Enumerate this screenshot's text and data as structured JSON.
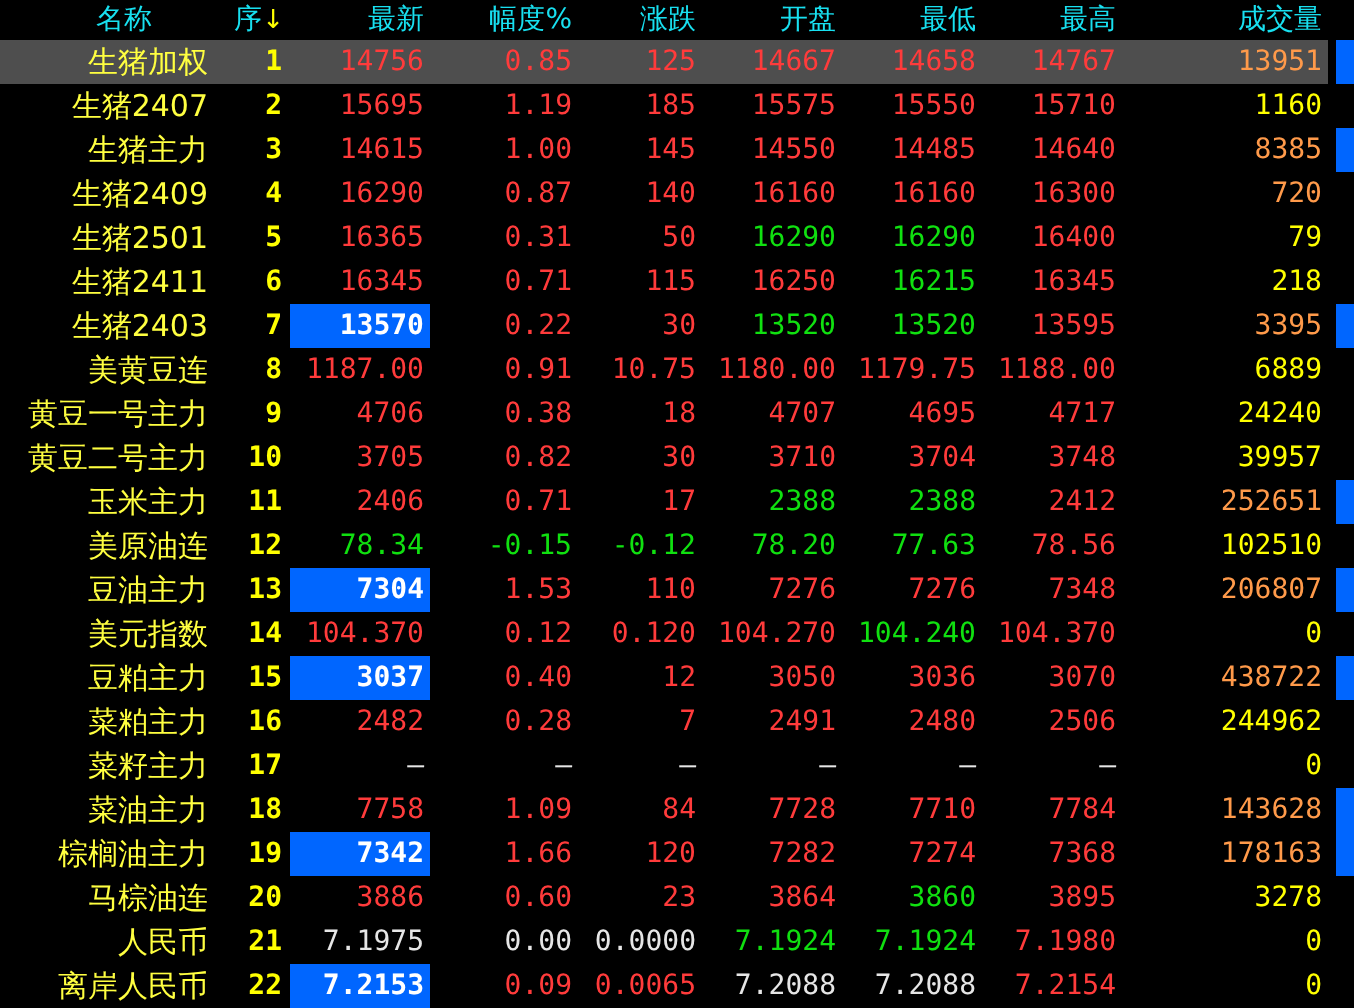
{
  "columns": [
    {
      "label": "名称"
    },
    {
      "label": "序",
      "sort_arrow": "↓"
    },
    {
      "label": "最新"
    },
    {
      "label": "幅度%"
    },
    {
      "label": "涨跌"
    },
    {
      "label": "开盘"
    },
    {
      "label": "最低"
    },
    {
      "label": "最高"
    },
    {
      "label": "成交量"
    }
  ],
  "rows": [
    {
      "name": "生猪加权",
      "seq": "1",
      "selected": true,
      "flash": false,
      "marker": true,
      "cells": [
        {
          "text": "14756",
          "color": "#ff3b3b"
        },
        {
          "text": "0.85",
          "color": "#ff3b3b"
        },
        {
          "text": "125",
          "color": "#ff3b3b"
        },
        {
          "text": "14667",
          "color": "#ff3b3b"
        },
        {
          "text": "14658",
          "color": "#ff3b3b"
        },
        {
          "text": "14767",
          "color": "#ff3b3b"
        },
        {
          "text": "13951",
          "color": "#ff9a4a"
        }
      ]
    },
    {
      "name": "生猪2407",
      "seq": "2",
      "selected": false,
      "flash": false,
      "marker": false,
      "cells": [
        {
          "text": "15695",
          "color": "#ff3b3b"
        },
        {
          "text": "1.19",
          "color": "#ff3b3b"
        },
        {
          "text": "185",
          "color": "#ff3b3b"
        },
        {
          "text": "15575",
          "color": "#ff3b3b"
        },
        {
          "text": "15550",
          "color": "#ff3b3b"
        },
        {
          "text": "15710",
          "color": "#ff3b3b"
        },
        {
          "text": "1160",
          "color": "#ffff00"
        }
      ]
    },
    {
      "name": "生猪主力",
      "seq": "3",
      "selected": false,
      "flash": false,
      "marker": true,
      "cells": [
        {
          "text": "14615",
          "color": "#ff3b3b"
        },
        {
          "text": "1.00",
          "color": "#ff3b3b"
        },
        {
          "text": "145",
          "color": "#ff3b3b"
        },
        {
          "text": "14550",
          "color": "#ff3b3b"
        },
        {
          "text": "14485",
          "color": "#ff3b3b"
        },
        {
          "text": "14640",
          "color": "#ff3b3b"
        },
        {
          "text": "8385",
          "color": "#ff9a4a"
        }
      ]
    },
    {
      "name": "生猪2409",
      "seq": "4",
      "selected": false,
      "flash": false,
      "marker": false,
      "cells": [
        {
          "text": "16290",
          "color": "#ff3b3b"
        },
        {
          "text": "0.87",
          "color": "#ff3b3b"
        },
        {
          "text": "140",
          "color": "#ff3b3b"
        },
        {
          "text": "16160",
          "color": "#ff3b3b"
        },
        {
          "text": "16160",
          "color": "#ff3b3b"
        },
        {
          "text": "16300",
          "color": "#ff3b3b"
        },
        {
          "text": "720",
          "color": "#ff9a4a"
        }
      ]
    },
    {
      "name": "生猪2501",
      "seq": "5",
      "selected": false,
      "flash": false,
      "marker": false,
      "cells": [
        {
          "text": "16365",
          "color": "#ff3b3b"
        },
        {
          "text": "0.31",
          "color": "#ff3b3b"
        },
        {
          "text": "50",
          "color": "#ff3b3b"
        },
        {
          "text": "16290",
          "color": "#10e010"
        },
        {
          "text": "16290",
          "color": "#10e010"
        },
        {
          "text": "16400",
          "color": "#ff3b3b"
        },
        {
          "text": "79",
          "color": "#ffff00"
        }
      ]
    },
    {
      "name": "生猪2411",
      "seq": "6",
      "selected": false,
      "flash": false,
      "marker": false,
      "cells": [
        {
          "text": "16345",
          "color": "#ff3b3b"
        },
        {
          "text": "0.71",
          "color": "#ff3b3b"
        },
        {
          "text": "115",
          "color": "#ff3b3b"
        },
        {
          "text": "16250",
          "color": "#ff3b3b"
        },
        {
          "text": "16215",
          "color": "#10e010"
        },
        {
          "text": "16345",
          "color": "#ff3b3b"
        },
        {
          "text": "218",
          "color": "#ffff00"
        }
      ]
    },
    {
      "name": "生猪2403",
      "seq": "7",
      "selected": false,
      "flash": true,
      "marker": true,
      "cells": [
        {
          "text": "13570"
        },
        {
          "text": "0.22",
          "color": "#ff3b3b"
        },
        {
          "text": "30",
          "color": "#ff3b3b"
        },
        {
          "text": "13520",
          "color": "#10e010"
        },
        {
          "text": "13520",
          "color": "#10e010"
        },
        {
          "text": "13595",
          "color": "#ff3b3b"
        },
        {
          "text": "3395",
          "color": "#ff9a4a"
        }
      ]
    },
    {
      "name": "美黄豆连",
      "seq": "8",
      "selected": false,
      "flash": false,
      "marker": false,
      "cells": [
        {
          "text": "1187.00",
          "color": "#ff3b3b"
        },
        {
          "text": "0.91",
          "color": "#ff3b3b"
        },
        {
          "text": "10.75",
          "color": "#ff3b3b"
        },
        {
          "text": "1180.00",
          "color": "#ff3b3b"
        },
        {
          "text": "1179.75",
          "color": "#ff3b3b"
        },
        {
          "text": "1188.00",
          "color": "#ff3b3b"
        },
        {
          "text": "6889",
          "color": "#ffff00"
        }
      ]
    },
    {
      "name": "黄豆一号主力",
      "seq": "9",
      "selected": false,
      "flash": false,
      "marker": false,
      "cells": [
        {
          "text": "4706",
          "color": "#ff3b3b"
        },
        {
          "text": "0.38",
          "color": "#ff3b3b"
        },
        {
          "text": "18",
          "color": "#ff3b3b"
        },
        {
          "text": "4707",
          "color": "#ff3b3b"
        },
        {
          "text": "4695",
          "color": "#ff3b3b"
        },
        {
          "text": "4717",
          "color": "#ff3b3b"
        },
        {
          "text": "24240",
          "color": "#ffff00"
        }
      ]
    },
    {
      "name": "黄豆二号主力",
      "seq": "10",
      "selected": false,
      "flash": false,
      "marker": false,
      "cells": [
        {
          "text": "3705",
          "color": "#ff3b3b"
        },
        {
          "text": "0.82",
          "color": "#ff3b3b"
        },
        {
          "text": "30",
          "color": "#ff3b3b"
        },
        {
          "text": "3710",
          "color": "#ff3b3b"
        },
        {
          "text": "3704",
          "color": "#ff3b3b"
        },
        {
          "text": "3748",
          "color": "#ff3b3b"
        },
        {
          "text": "39957",
          "color": "#ffff00"
        }
      ]
    },
    {
      "name": "玉米主力",
      "seq": "11",
      "selected": false,
      "flash": false,
      "marker": true,
      "cells": [
        {
          "text": "2406",
          "color": "#ff3b3b"
        },
        {
          "text": "0.71",
          "color": "#ff3b3b"
        },
        {
          "text": "17",
          "color": "#ff3b3b"
        },
        {
          "text": "2388",
          "color": "#10e010"
        },
        {
          "text": "2388",
          "color": "#10e010"
        },
        {
          "text": "2412",
          "color": "#ff3b3b"
        },
        {
          "text": "252651",
          "color": "#ff9a4a"
        }
      ]
    },
    {
      "name": "美原油连",
      "seq": "12",
      "selected": false,
      "flash": false,
      "marker": false,
      "cells": [
        {
          "text": "78.34",
          "color": "#10e010"
        },
        {
          "text": "-0.15",
          "color": "#10e010"
        },
        {
          "text": "-0.12",
          "color": "#10e010"
        },
        {
          "text": "78.20",
          "color": "#10e010"
        },
        {
          "text": "77.63",
          "color": "#10e010"
        },
        {
          "text": "78.56",
          "color": "#ff3b3b"
        },
        {
          "text": "102510",
          "color": "#ffff00"
        }
      ]
    },
    {
      "name": "豆油主力",
      "seq": "13",
      "selected": false,
      "flash": true,
      "marker": true,
      "cells": [
        {
          "text": "7304"
        },
        {
          "text": "1.53",
          "color": "#ff3b3b"
        },
        {
          "text": "110",
          "color": "#ff3b3b"
        },
        {
          "text": "7276",
          "color": "#ff3b3b"
        },
        {
          "text": "7276",
          "color": "#ff3b3b"
        },
        {
          "text": "7348",
          "color": "#ff3b3b"
        },
        {
          "text": "206807",
          "color": "#ff9a4a"
        }
      ]
    },
    {
      "name": "美元指数",
      "seq": "14",
      "selected": false,
      "flash": false,
      "marker": false,
      "cells": [
        {
          "text": "104.370",
          "color": "#ff3b3b"
        },
        {
          "text": "0.12",
          "color": "#ff3b3b"
        },
        {
          "text": "0.120",
          "color": "#ff3b3b"
        },
        {
          "text": "104.270",
          "color": "#ff3b3b"
        },
        {
          "text": "104.240",
          "color": "#10e010"
        },
        {
          "text": "104.370",
          "color": "#ff3b3b"
        },
        {
          "text": "0",
          "color": "#ffff00"
        }
      ]
    },
    {
      "name": "豆粕主力",
      "seq": "15",
      "selected": false,
      "flash": true,
      "marker": true,
      "cells": [
        {
          "text": "3037"
        },
        {
          "text": "0.40",
          "color": "#ff3b3b"
        },
        {
          "text": "12",
          "color": "#ff3b3b"
        },
        {
          "text": "3050",
          "color": "#ff3b3b"
        },
        {
          "text": "3036",
          "color": "#ff3b3b"
        },
        {
          "text": "3070",
          "color": "#ff3b3b"
        },
        {
          "text": "438722",
          "color": "#ff9a4a"
        }
      ]
    },
    {
      "name": "菜粕主力",
      "seq": "16",
      "selected": false,
      "flash": false,
      "marker": false,
      "cells": [
        {
          "text": "2482",
          "color": "#ff3b3b"
        },
        {
          "text": "0.28",
          "color": "#ff3b3b"
        },
        {
          "text": "7",
          "color": "#ff3b3b"
        },
        {
          "text": "2491",
          "color": "#ff3b3b"
        },
        {
          "text": "2480",
          "color": "#ff3b3b"
        },
        {
          "text": "2506",
          "color": "#ff3b3b"
        },
        {
          "text": "244962",
          "color": "#ffff00"
        }
      ]
    },
    {
      "name": "菜籽主力",
      "seq": "17",
      "selected": false,
      "flash": false,
      "marker": false,
      "cells": [
        {
          "text": "—",
          "color": "#e6e6e6"
        },
        {
          "text": "—",
          "color": "#e6e6e6"
        },
        {
          "text": "—",
          "color": "#e6e6e6"
        },
        {
          "text": "—",
          "color": "#e6e6e6"
        },
        {
          "text": "—",
          "color": "#e6e6e6"
        },
        {
          "text": "—",
          "color": "#e6e6e6"
        },
        {
          "text": "0",
          "color": "#ffff00"
        }
      ]
    },
    {
      "name": "菜油主力",
      "seq": "18",
      "selected": false,
      "flash": false,
      "marker": true,
      "cells": [
        {
          "text": "7758",
          "color": "#ff3b3b"
        },
        {
          "text": "1.09",
          "color": "#ff3b3b"
        },
        {
          "text": "84",
          "color": "#ff3b3b"
        },
        {
          "text": "7728",
          "color": "#ff3b3b"
        },
        {
          "text": "7710",
          "color": "#ff3b3b"
        },
        {
          "text": "7784",
          "color": "#ff3b3b"
        },
        {
          "text": "143628",
          "color": "#ff9a4a"
        }
      ]
    },
    {
      "name": "棕榈油主力",
      "seq": "19",
      "selected": false,
      "flash": true,
      "marker": true,
      "cells": [
        {
          "text": "7342"
        },
        {
          "text": "1.66",
          "color": "#ff3b3b"
        },
        {
          "text": "120",
          "color": "#ff3b3b"
        },
        {
          "text": "7282",
          "color": "#ff3b3b"
        },
        {
          "text": "7274",
          "color": "#ff3b3b"
        },
        {
          "text": "7368",
          "color": "#ff3b3b"
        },
        {
          "text": "178163",
          "color": "#ff9a4a"
        }
      ]
    },
    {
      "name": "马棕油连",
      "seq": "20",
      "selected": false,
      "flash": false,
      "marker": false,
      "cells": [
        {
          "text": "3886",
          "color": "#ff3b3b"
        },
        {
          "text": "0.60",
          "color": "#ff3b3b"
        },
        {
          "text": "23",
          "color": "#ff3b3b"
        },
        {
          "text": "3864",
          "color": "#ff3b3b"
        },
        {
          "text": "3860",
          "color": "#10e010"
        },
        {
          "text": "3895",
          "color": "#ff3b3b"
        },
        {
          "text": "3278",
          "color": "#ffff00"
        }
      ]
    },
    {
      "name": "人民币",
      "seq": "21",
      "selected": false,
      "flash": false,
      "marker": false,
      "cells": [
        {
          "text": "7.1975",
          "color": "#e6e6e6"
        },
        {
          "text": "0.00",
          "color": "#e6e6e6"
        },
        {
          "text": "0.0000",
          "color": "#e6e6e6"
        },
        {
          "text": "7.1924",
          "color": "#10e010"
        },
        {
          "text": "7.1924",
          "color": "#10e010"
        },
        {
          "text": "7.1980",
          "color": "#ff3b3b"
        },
        {
          "text": "0",
          "color": "#ffff00"
        }
      ]
    },
    {
      "name": "离岸人民币",
      "seq": "22",
      "selected": false,
      "flash": true,
      "marker": false,
      "cells": [
        {
          "text": "7.2153"
        },
        {
          "text": "0.09",
          "color": "#ff3b3b"
        },
        {
          "text": "0.0065",
          "color": "#ff3b3b"
        },
        {
          "text": "7.2088",
          "color": "#e6e6e6"
        },
        {
          "text": "7.2088",
          "color": "#e6e6e6"
        },
        {
          "text": "7.2154",
          "color": "#ff3b3b"
        },
        {
          "text": "0",
          "color": "#ffff00"
        }
      ]
    }
  ]
}
